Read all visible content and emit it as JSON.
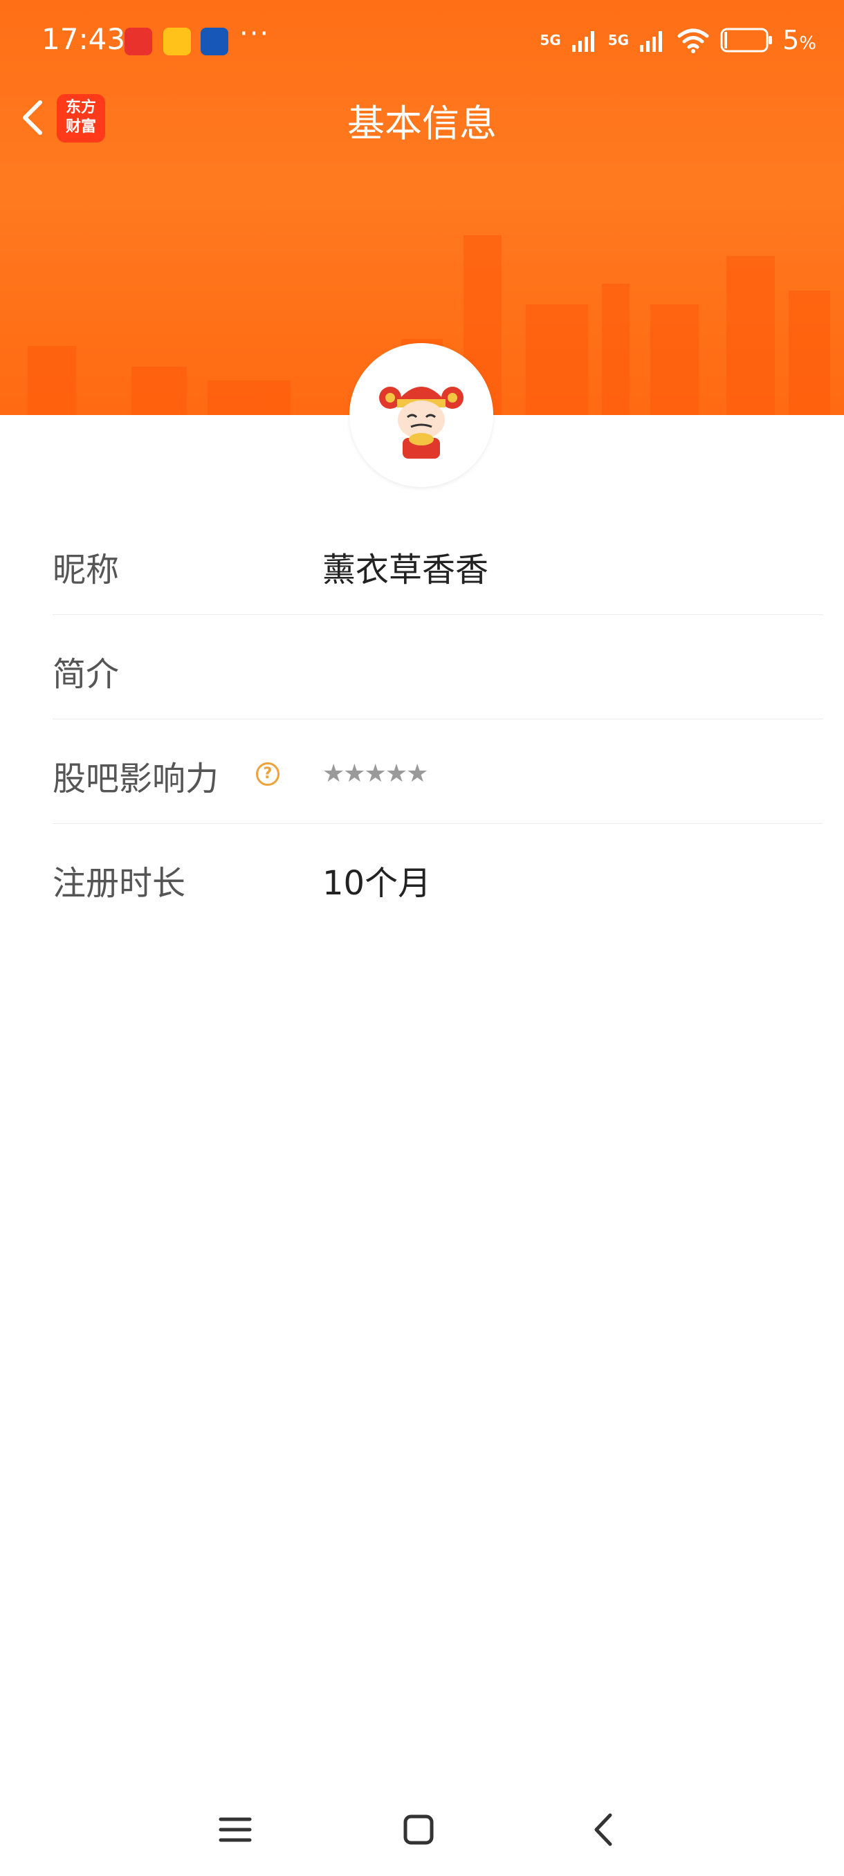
{
  "status_bar": {
    "time": "17:43",
    "dots": "···",
    "net1": "5G",
    "net2": "5G",
    "battery": "5",
    "battery_unit": "%"
  },
  "header": {
    "app_badge_line1": "东方",
    "app_badge_line2": "财富",
    "title": "基本信息"
  },
  "profile": {
    "rows": [
      {
        "label": "昵称",
        "value": "薰衣草香香"
      },
      {
        "label": "简介",
        "value": ""
      },
      {
        "label": "股吧影响力",
        "help": "?",
        "stars": "★★★★★"
      },
      {
        "label": "注册时长",
        "value": "10个月"
      }
    ]
  },
  "colors": {
    "banner": "#ff7a1f",
    "help_icon": "#f0a23a",
    "badge": "#ff3a1a"
  },
  "icons": [
    "back-icon",
    "avatar-caishen-icon",
    "help-icon",
    "menu-icon",
    "home-icon",
    "nav-back-icon",
    "wifi-icon",
    "battery-icon",
    "signal-icon"
  ]
}
